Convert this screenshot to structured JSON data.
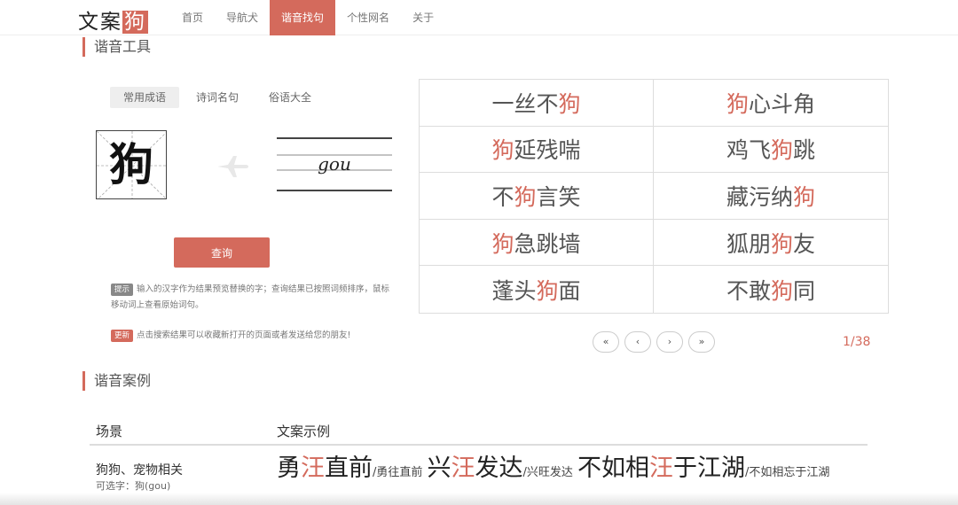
{
  "logo": {
    "text": "文案",
    "accent": "狗"
  },
  "nav": {
    "items": [
      {
        "label": "首页"
      },
      {
        "label": "导航犬"
      },
      {
        "label": "谐音找句"
      },
      {
        "label": "个性网名"
      },
      {
        "label": "关于"
      }
    ],
    "active": "谐音找句"
  },
  "tool": {
    "title": "谐音工具",
    "tabs": [
      {
        "label": "常用成语"
      },
      {
        "label": "诗词名句"
      },
      {
        "label": "俗语大全"
      }
    ],
    "active_tab": "常用成语",
    "input_char": "狗",
    "pinyin": "gou",
    "query_label": "查询",
    "tip_badge": "提示",
    "tip_text": "输入的汉字作为结果预览替换的字；查询结果已按照词频排序，鼠标移动词上查看原始词句。",
    "update_badge": "更新",
    "update_text": "点击搜索结果可以收藏新打开的页面或者发送给您的朋友!"
  },
  "results": [
    {
      "pre": "一丝不",
      "hl": "狗",
      "post": ""
    },
    {
      "pre": "",
      "hl": "狗",
      "post": "心斗角"
    },
    {
      "pre": "",
      "hl": "狗",
      "post": "延残喘"
    },
    {
      "pre": "鸡飞",
      "hl": "狗",
      "post": "跳"
    },
    {
      "pre": "不",
      "hl": "狗",
      "post": "言笑"
    },
    {
      "pre": "藏污纳",
      "hl": "狗",
      "post": ""
    },
    {
      "pre": "",
      "hl": "狗",
      "post": "急跳墙"
    },
    {
      "pre": "狐朋",
      "hl": "狗",
      "post": "友"
    },
    {
      "pre": "蓬头",
      "hl": "狗",
      "post": "面"
    },
    {
      "pre": "不敢",
      "hl": "狗",
      "post": "同"
    }
  ],
  "pager": {
    "first": "«",
    "prev": "‹",
    "next": "›",
    "last": "»",
    "count": "1/38"
  },
  "cases": {
    "title": "谐音案例",
    "col_scene": "场景",
    "col_example": "文案示例",
    "rows": [
      {
        "scene": "狗狗、宠物相关",
        "sub": "可选字：狗(gou)",
        "examples": [
          {
            "pre": "勇",
            "hl": "汪",
            "post": "直前",
            "orig": "/勇往直前"
          },
          {
            "pre": "兴",
            "hl": "汪",
            "post": "发达",
            "orig": "/兴旺发达"
          },
          {
            "pre": "不如相",
            "hl": "汪",
            "post": "于江湖",
            "orig": "/不如相忘于江湖"
          }
        ]
      }
    ]
  },
  "colors": {
    "accent": "#d46a5c",
    "border": "#dddddd",
    "text": "#333333"
  },
  "icons": {
    "plane": "airplane-icon"
  }
}
